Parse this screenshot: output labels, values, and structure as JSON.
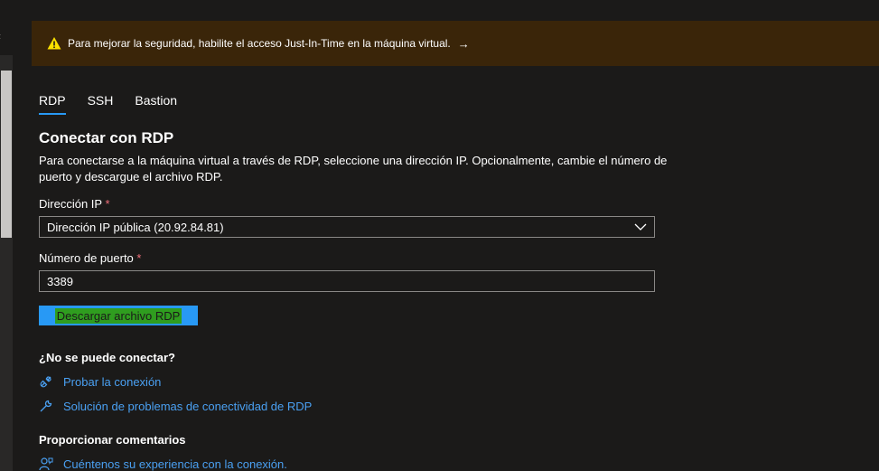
{
  "banner": {
    "text": "Para mejorar la seguridad, habilite el acceso Just-In-Time en la máquina virtual.",
    "icon": "warning-icon",
    "arrow_icon": "arrow-right-icon",
    "color": "#3a2509"
  },
  "tabs": [
    {
      "label": "RDP",
      "active": true
    },
    {
      "label": "SSH",
      "active": false
    },
    {
      "label": "Bastion",
      "active": false
    }
  ],
  "rdp": {
    "title": "Conectar con RDP",
    "description": "Para conectarse a la máquina virtual a través de RDP, seleccione una dirección IP. Opcionalmente, cambie el número de puerto y descargue el archivo RDP.",
    "ip_label": "Dirección IP",
    "ip_value": "Dirección IP pública (20.92.84.81)",
    "port_label": "Número de puerto",
    "port_value": "3389",
    "download_button": "Descargar archivo RDP",
    "required_mark": "*"
  },
  "help": {
    "title": "¿No se puede conectar?",
    "links": [
      {
        "label": "Probar la conexión",
        "icon": "plug-icon"
      },
      {
        "label": "Solución de problemas de conectividad de RDP",
        "icon": "wrench-icon"
      }
    ]
  },
  "feedback": {
    "title": "Proporcionar comentarios",
    "link": {
      "label": "Cuéntenos su experiencia con la conexión.",
      "icon": "feedback-icon"
    }
  },
  "colors": {
    "accent": "#2899f5",
    "link": "#4aa0f2",
    "required": "#f1707b",
    "background": "#1b1a19"
  }
}
